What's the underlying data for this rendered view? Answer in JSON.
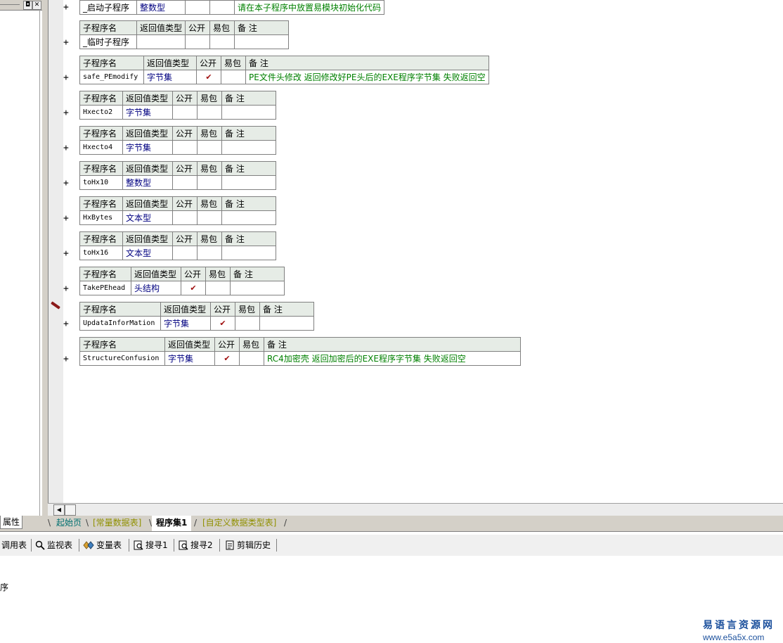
{
  "window": {
    "restore_glyph": "◘",
    "close_glyph": "✕"
  },
  "gutter": {
    "plus": "+"
  },
  "headers": {
    "name": "子程序名",
    "ret": "返回值类型",
    "public": "公开",
    "easy": "易包",
    "remark": "备 注"
  },
  "subs": [
    {
      "name": "_启动子程序",
      "ret": "整数型",
      "public": "",
      "easy": "",
      "remark": "请在本子程序中放置易模块初始化代码"
    },
    {
      "name": "_临时子程序",
      "ret": "",
      "public": "",
      "easy": "",
      "remark": ""
    },
    {
      "name": "safe_PEmodify",
      "ret": "字节集",
      "public": "✔",
      "easy": "",
      "remark": "PE文件头修改 返回修改好PE头后的EXE程序字节集 失败返回空"
    },
    {
      "name": "Hxecto2",
      "ret": "字节集",
      "public": "",
      "easy": "",
      "remark": ""
    },
    {
      "name": "Hxecto4",
      "ret": "字节集",
      "public": "",
      "easy": "",
      "remark": ""
    },
    {
      "name": "toHx10",
      "ret": "整数型",
      "public": "",
      "easy": "",
      "remark": ""
    },
    {
      "name": "HxBytes",
      "ret": "文本型",
      "public": "",
      "easy": "",
      "remark": ""
    },
    {
      "name": "toHx16",
      "ret": "文本型",
      "public": "",
      "easy": "",
      "remark": ""
    },
    {
      "name": "TakePEhead",
      "ret": "头结构",
      "public": "✔",
      "easy": "",
      "remark": ""
    },
    {
      "name": "UpdataInforMation",
      "ret": "字节集",
      "public": "✔",
      "easy": "",
      "remark": ""
    },
    {
      "name": "StructureConfusion",
      "ret": "字节集",
      "public": "✔",
      "easy": "",
      "remark": "RC4加密壳 返回加密后的EXE程序字节集 失败返回空"
    }
  ],
  "scroll": {
    "left_arrow": "◀"
  },
  "tabs": {
    "properties": "属性",
    "start": "起始页",
    "const": "[常量数据表]",
    "active": "程序集1",
    "custom": "[自定义数据类型表]"
  },
  "toolbar": {
    "call": "调用表",
    "watch": "监视表",
    "vars": "变量表",
    "search1": "搜寻1",
    "search2": "搜寻2",
    "clip": "剪辑历史"
  },
  "output": {
    "text": "序"
  },
  "watermark": {
    "title": "易语言资源网",
    "url": "www.e5a5x.com"
  }
}
